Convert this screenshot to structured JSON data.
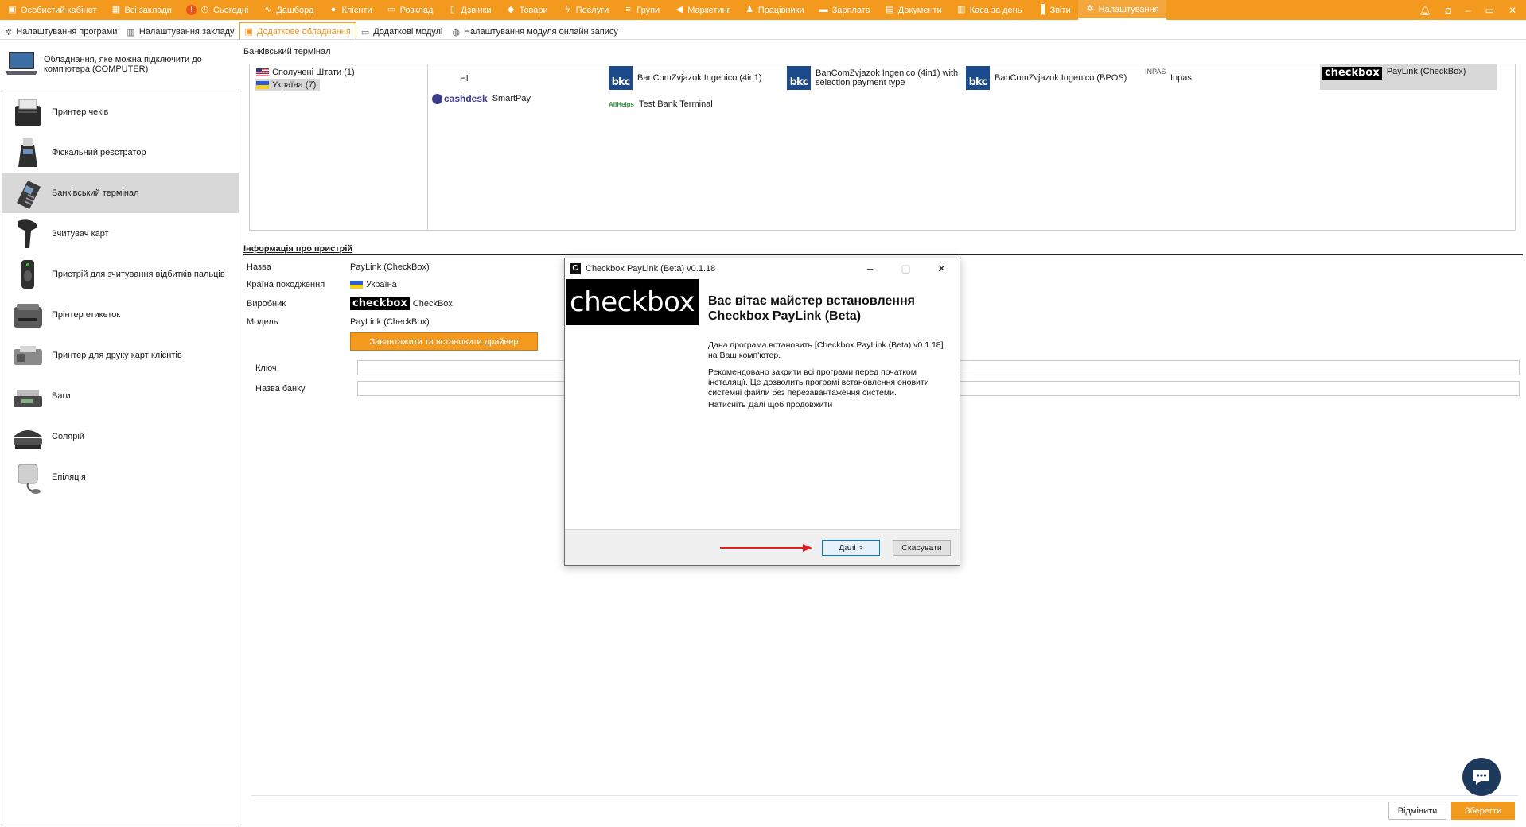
{
  "topnav": {
    "items": [
      {
        "label": "Особистий кабінет",
        "icon": "briefcase-icon",
        "glyph": "▣"
      },
      {
        "label": "Всі заклади",
        "icon": "grid-icon",
        "glyph": "▦"
      },
      {
        "label": "Сьогодні",
        "icon": "clock-icon",
        "glyph": "◷"
      },
      {
        "label": "Дашборд",
        "icon": "pulse-icon",
        "glyph": "∿"
      },
      {
        "label": "Клієнти",
        "icon": "user-circle-icon",
        "glyph": "●"
      },
      {
        "label": "Розклад",
        "icon": "calendar-icon",
        "glyph": "▭"
      },
      {
        "label": "Дзвінки",
        "icon": "phone-icon",
        "glyph": "▯"
      },
      {
        "label": "Товари",
        "icon": "box-icon",
        "glyph": "◆"
      },
      {
        "label": "Послуги",
        "icon": "lightning-icon",
        "glyph": "ϟ"
      },
      {
        "label": "Групи",
        "icon": "layers-icon",
        "glyph": "≡"
      },
      {
        "label": "Маркетинг",
        "icon": "megaphone-icon",
        "glyph": "◀"
      },
      {
        "label": "Працівники",
        "icon": "person-icon",
        "glyph": "♟"
      },
      {
        "label": "Зарплата",
        "icon": "cash-icon",
        "glyph": "▬"
      },
      {
        "label": "Документи",
        "icon": "document-icon",
        "glyph": "▤"
      },
      {
        "label": "Каса за день",
        "icon": "calculator-icon",
        "glyph": "▥"
      },
      {
        "label": "Звіти",
        "icon": "bar-chart-icon",
        "glyph": "▐"
      },
      {
        "label": "Налаштування",
        "icon": "gear-icon",
        "glyph": "✲"
      }
    ],
    "today_badge": "!"
  },
  "subtabs": [
    {
      "label": "Налаштування програми",
      "icon": "gear-icon",
      "glyph": "✲"
    },
    {
      "label": "Налаштування закладу",
      "icon": "building-icon",
      "glyph": "▥"
    },
    {
      "label": "Додаткове обладнання",
      "icon": "printer-icon",
      "glyph": "▣"
    },
    {
      "label": "Додаткові модулі",
      "icon": "module-icon",
      "glyph": "▭"
    },
    {
      "label": "Налаштування модуля онлайн запису",
      "icon": "globe-icon",
      "glyph": "◍"
    }
  ],
  "left": {
    "header": "Обладнання, яке можна підключити до комп'ютера (COMPUTER)",
    "categories": [
      {
        "label": "Принтер чеків",
        "icon": "receipt-printer-icon"
      },
      {
        "label": "Фіскальний реєстратор",
        "icon": "fiscal-register-icon"
      },
      {
        "label": "Банківський термінал",
        "icon": "bank-terminal-icon"
      },
      {
        "label": "Зчитувач карт",
        "icon": "card-scanner-icon"
      },
      {
        "label": "Пристрій для зчитування відбитків пальців",
        "icon": "fingerprint-reader-icon"
      },
      {
        "label": "Прінтер етикеток",
        "icon": "label-printer-icon"
      },
      {
        "label": "Принтер для друку карт клієнтів",
        "icon": "card-printer-icon"
      },
      {
        "label": "Ваги",
        "icon": "scales-icon"
      },
      {
        "label": "Солярій",
        "icon": "solarium-icon"
      },
      {
        "label": "Епіляція",
        "icon": "epilation-icon"
      }
    ]
  },
  "terminal": {
    "title": "Банківський термінал",
    "countries": [
      "Сполучені Штати (1)",
      "Україна (7)"
    ],
    "devices": {
      "hi": "Hi",
      "smartpay_logo": "cashdesk",
      "smartpay": "SmartPay",
      "ingenico_4in1": "BanComZvjazok Ingenico (4in1)",
      "ingenico_4in1_sel_1": "BanComZvjazok Ingenico (4in1) with",
      "ingenico_4in1_sel_2": "selection payment type",
      "ingenico_bpos": "BanComZvjazok Ingenico (BPOS)",
      "inpas_logo": "INPAS",
      "inpas": "Inpas",
      "paylink_logo": "checkbox",
      "paylink": "PayLink (CheckBox)",
      "allhelps_logo": "AllHelps",
      "test": "Test Bank Terminal",
      "bkc_logo": "bkc"
    }
  },
  "info": {
    "header": "Інформація про пристрій",
    "name_label": "Назва",
    "name": "PayLink (CheckBox)",
    "country_label": "Країна походження",
    "country": "Україна",
    "maker_label": "Виробник",
    "maker_logo": "checkbox",
    "maker": "CheckBox",
    "model_label": "Модель",
    "model": "PayLink (CheckBox)",
    "install_button": "Завантажити та встановити драйвер",
    "key_label": "Ключ",
    "bank_label": "Назва банку",
    "key_value": "",
    "bank_value": ""
  },
  "footer": {
    "cancel": "Відмінити",
    "save": "Зберегти"
  },
  "modal": {
    "app_icon": "C",
    "title": "Checkbox PayLink (Beta) v0.1.18",
    "logo": "checkbox",
    "heading": "Вас вітає майстер встановлення Checkbox PayLink (Beta)",
    "p1": "Дана програма встановить [Checkbox PayLink (Beta) v0.1.18] на Ваш комп'ютер.",
    "p2": "Рекомендовано закрити всі програми перед початком інсталяції. Це дозволить програмі встановлення оновити системні файли без перезавантаження системи.",
    "p3": "Натисніть Далі щоб продовжити",
    "next": "Далі >",
    "cancel": "Скасувати"
  },
  "colors": {
    "accent": "#f39a1e",
    "selected_bg": "#d8d8d8",
    "chat": "#1d3a5c",
    "arrow": "#e02020"
  }
}
